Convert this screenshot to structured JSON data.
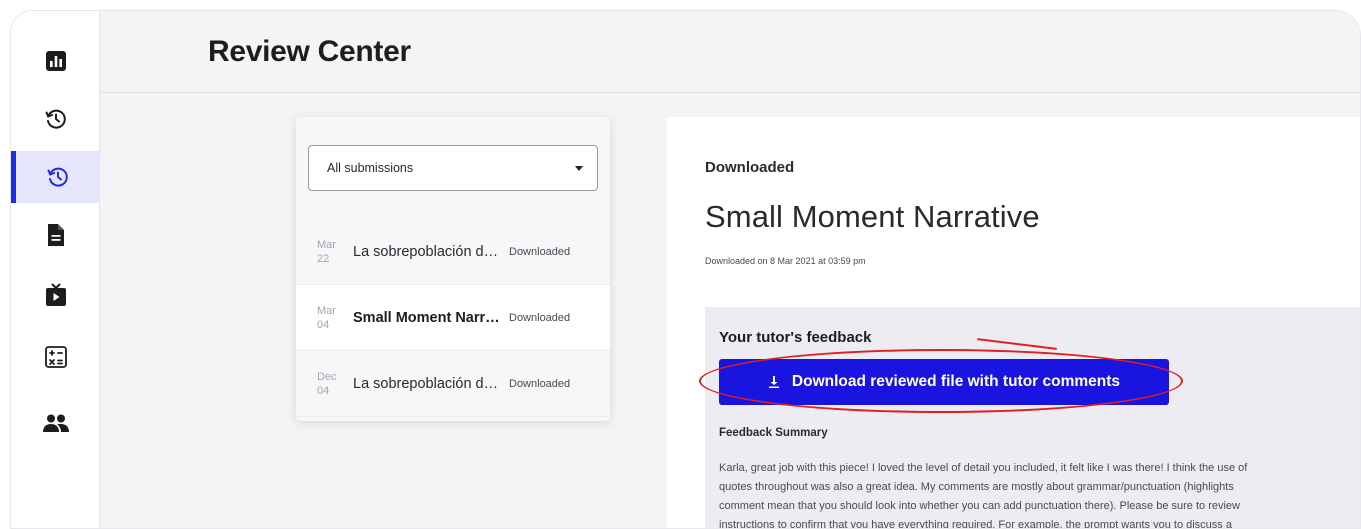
{
  "header": {
    "title": "Review Center"
  },
  "sidebar": {
    "items": [
      {
        "name": "stats",
        "icon": "bar-chart-icon"
      },
      {
        "name": "history",
        "icon": "history-icon"
      },
      {
        "name": "review-history",
        "icon": "history-icon",
        "active": true
      },
      {
        "name": "documents",
        "icon": "document-icon"
      },
      {
        "name": "videos",
        "icon": "tv-icon"
      },
      {
        "name": "calculator",
        "icon": "calculator-icon"
      },
      {
        "name": "groups",
        "icon": "people-icon"
      }
    ],
    "accent_color": "#1f2ddb"
  },
  "submissions": {
    "filter": {
      "selected": "All submissions"
    },
    "items": [
      {
        "month": "Mar",
        "day": "22",
        "title": "La sobrepoblación de la tierra",
        "status": "Downloaded",
        "selected": false
      },
      {
        "month": "Mar",
        "day": "04",
        "title": "Small Moment Narrative",
        "status": "Downloaded",
        "selected": true
      },
      {
        "month": "Dec",
        "day": "04",
        "title": "La sobrepoblación de la tierra",
        "status": "Downloaded",
        "selected": false
      }
    ]
  },
  "detail": {
    "status": "Downloaded",
    "title": "Small Moment Narrative",
    "downloaded_on": "Downloaded on 8 Mar 2021 at 03:59 pm",
    "feedback": {
      "heading": "Your tutor's feedback",
      "download_button": "Download reviewed file with tutor comments",
      "summary_heading": "Feedback Summary",
      "summary_lines": [
        "Karla, great job with this piece! I loved the level of detail you included, it felt like I was there! I think the use of",
        "quotes throughout was also a great idea. My comments are mostly about grammar/punctuation (highlights",
        "comment mean that you should look into whether you can add punctuation there). Please be sure to review",
        "instructions to confirm that you have everything required. For example, the prompt wants you to discuss a"
      ]
    },
    "button_color": "#1a14e0",
    "annotation_color": "#e02020"
  }
}
